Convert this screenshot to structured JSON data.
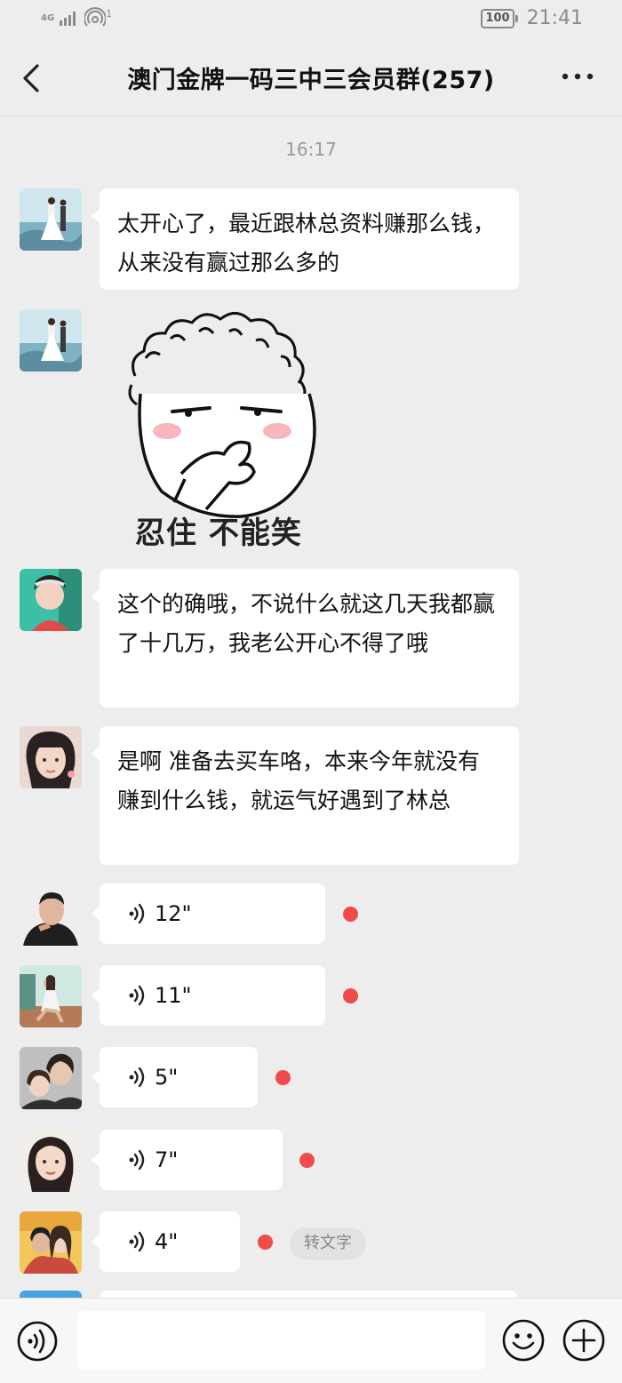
{
  "status_bar": {
    "network": "4G",
    "signal_icon": "signal-bars-icon",
    "hotspot_badge": "1",
    "battery": "100",
    "time": "21:41"
  },
  "nav": {
    "back_icon": "chevron-left-icon",
    "title": "澳门金牌一码三中三会员群(257)",
    "more_icon": "more-dots-icon"
  },
  "timestamp": "16:17",
  "messages": [
    {
      "type": "text",
      "text": "太开心了，最近跟林总资料赚那么钱，从来没有赢过那么多的"
    },
    {
      "type": "sticker",
      "caption": "忍住 不能笑"
    },
    {
      "type": "text",
      "text": "这个的确哦，不说什么就这几天我都赢了十几万，我老公开心不得了哦"
    },
    {
      "type": "text",
      "text": "是啊  准备去买车咯，本来今年就没有赚到什么钱，就运气好遇到了林总"
    },
    {
      "type": "voice",
      "duration": "12\"",
      "unread": true
    },
    {
      "type": "voice",
      "duration": "11\"",
      "unread": true
    },
    {
      "type": "voice",
      "duration": "5\"",
      "unread": true
    },
    {
      "type": "voice",
      "duration": "7\"",
      "unread": true
    },
    {
      "type": "voice",
      "duration": "4\"",
      "unread": true,
      "action": "转文字"
    }
  ],
  "input_bar": {
    "voice_icon": "voice-input-icon",
    "emoji_icon": "emoji-icon",
    "plus_icon": "plus-icon",
    "value": ""
  },
  "colors": {
    "background": "#ededed",
    "bubble": "#ffffff",
    "unread_dot": "#f04a4a"
  }
}
